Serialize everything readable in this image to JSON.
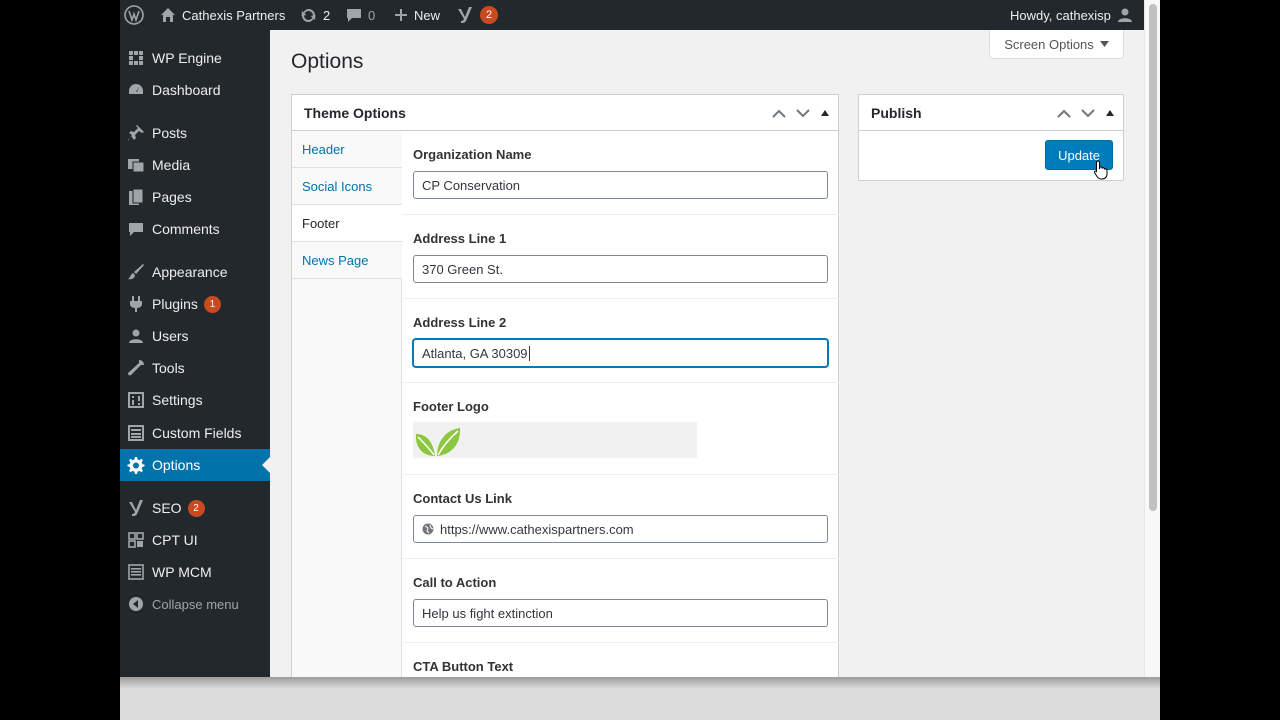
{
  "admin_bar": {
    "site_name": "Cathexis Partners",
    "updates_count": "2",
    "comments_count": "0",
    "new_label": "New",
    "yoast_count": "2",
    "greeting": "Howdy, cathexisp"
  },
  "sidebar": {
    "items": [
      {
        "label": "WP Engine",
        "icon": "wpengine-icon"
      },
      {
        "label": "Dashboard",
        "icon": "dashboard-icon"
      },
      {
        "label": "Posts",
        "icon": "pin-icon"
      },
      {
        "label": "Media",
        "icon": "media-icon"
      },
      {
        "label": "Pages",
        "icon": "pages-icon"
      },
      {
        "label": "Comments",
        "icon": "comment-icon"
      },
      {
        "label": "Appearance",
        "icon": "brush-icon"
      },
      {
        "label": "Plugins",
        "icon": "plugin-icon",
        "badge": "1"
      },
      {
        "label": "Users",
        "icon": "user-icon"
      },
      {
        "label": "Tools",
        "icon": "wrench-icon"
      },
      {
        "label": "Settings",
        "icon": "settings-icon"
      },
      {
        "label": "Custom Fields",
        "icon": "fields-icon"
      },
      {
        "label": "Options",
        "icon": "gear-icon",
        "active": true
      },
      {
        "label": "SEO",
        "icon": "yoast-icon",
        "badge": "2"
      },
      {
        "label": "CPT UI",
        "icon": "cptui-icon"
      },
      {
        "label": "WP MCM",
        "icon": "list-icon"
      },
      {
        "label": "Collapse menu",
        "icon": "collapse-icon"
      }
    ]
  },
  "screen_options_label": "Screen Options",
  "page_title": "Options",
  "theme_options": {
    "title": "Theme Options",
    "tabs": [
      "Header",
      "Social Icons",
      "Footer",
      "News Page"
    ],
    "active_tab": "Footer",
    "fields": [
      {
        "label": "Organization Name",
        "value": "CP Conservation"
      },
      {
        "label": "Address Line 1",
        "value": "370 Green St."
      },
      {
        "label": "Address Line 2",
        "value": "Atlanta, GA 30309"
      },
      {
        "label": "Footer Logo"
      },
      {
        "label": "Contact Us Link",
        "value": "https://www.cathexispartners.com"
      },
      {
        "label": "Call to Action",
        "value": "Help us fight extinction"
      },
      {
        "label": "CTA Button Text"
      }
    ]
  },
  "publish": {
    "title": "Publish",
    "update_label": "Update"
  },
  "colors": {
    "admin_dark": "#23282d",
    "accent_blue": "#0073aa",
    "badge_orange": "#ca4a1f",
    "leaf_green": "#8dc63f"
  }
}
